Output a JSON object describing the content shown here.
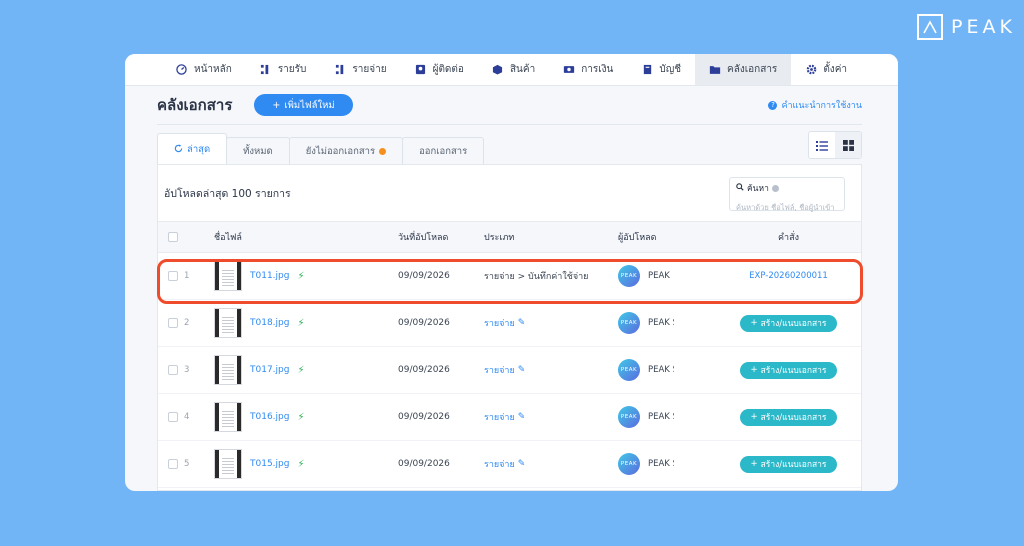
{
  "brand": {
    "logo_text": "PEAK"
  },
  "nav": [
    {
      "label": "หน้าหลัก",
      "icon": "dashboard-icon"
    },
    {
      "label": "รายรับ",
      "icon": "income-icon"
    },
    {
      "label": "รายจ่าย",
      "icon": "expense-icon"
    },
    {
      "label": "ผู้ติดต่อ",
      "icon": "contact-icon"
    },
    {
      "label": "สินค้า",
      "icon": "box-icon"
    },
    {
      "label": "การเงิน",
      "icon": "money-icon"
    },
    {
      "label": "บัญชี",
      "icon": "book-icon"
    },
    {
      "label": "คลังเอกสาร",
      "icon": "folder-icon"
    },
    {
      "label": "ตั้งค่า",
      "icon": "gear-icon"
    }
  ],
  "header": {
    "title": "คลังเอกสาร",
    "add_button": "เพิ่มไฟล์ใหม่",
    "help_link": "คำแนะนำการใช้งาน"
  },
  "tabs": [
    "ล่าสุด",
    "ทั้งหมด",
    "ยังไม่ออกเอกสาร",
    "ออกเอกสาร"
  ],
  "panel": {
    "upload_count": "อัปโหลดล่าสุด 100 รายการ",
    "search_label": "ค้นหา",
    "search_placeholder": "ค้นหาด้วย ชื่อไฟล์, ชื่อผู้นำเข้า"
  },
  "table": {
    "headers": {
      "file": "ชื่อไฟล์",
      "date": "วันที่อัปโหลด",
      "type": "ประเภท",
      "uploader": "ผู้อัปโหลด",
      "command": "คำสั่ง"
    },
    "rows": [
      {
        "num": "1",
        "file": "T011.jpg",
        "date": "09/09/2026",
        "type": "รายจ่าย > บันทึกค่าใช้จ่าย",
        "uploader": "PEAK",
        "command": "EXP-20260200011"
      },
      {
        "num": "2",
        "file": "T018.jpg",
        "date": "09/09/2026",
        "type": "รายจ่าย",
        "uploader": "PEAK S",
        "command": "สร้าง/แนบเอกสาร"
      },
      {
        "num": "3",
        "file": "T017.jpg",
        "date": "09/09/2026",
        "type": "รายจ่าย",
        "uploader": "PEAK S",
        "command": "สร้าง/แนบเอกสาร"
      },
      {
        "num": "4",
        "file": "T016.jpg",
        "date": "09/09/2026",
        "type": "รายจ่าย",
        "uploader": "PEAK S",
        "command": "สร้าง/แนบเอกสาร"
      },
      {
        "num": "5",
        "file": "T015.jpg",
        "date": "09/09/2026",
        "type": "รายจ่าย",
        "uploader": "PEAK S",
        "command": "สร้าง/แนบเอกสาร"
      }
    ],
    "avatar_text": "PEAK"
  },
  "colors": {
    "background": "#72b5f7",
    "primary": "#2f8af2",
    "accent_button": "#2bb8c9",
    "highlight": "#ee4c2c",
    "pending_dot": "#f5901e"
  }
}
